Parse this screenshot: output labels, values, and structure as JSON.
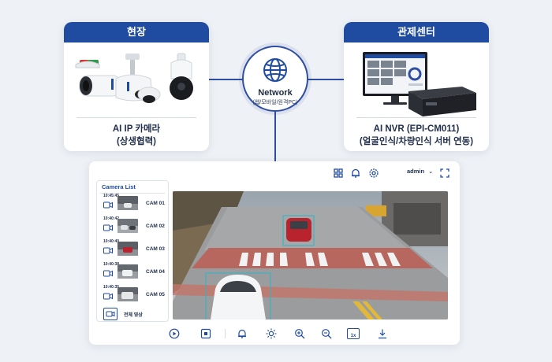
{
  "left_card": {
    "header": "현장",
    "caption_line1": "AI IP 카메라",
    "caption_line2": "(상생협력)"
  },
  "right_card": {
    "header": "관제센터",
    "caption_line1": "AI NVR (EPI-CM011)",
    "caption_line2": "(얼굴인식/차량인식 서버 연동)"
  },
  "hub": {
    "title": "Network",
    "subtitle": "(웹/모바일/원격PC)",
    "icon": "globe-icon"
  },
  "viewer": {
    "user": "admin",
    "camera_list_title": "Camera List",
    "cameras": [
      {
        "time": "10:45:45",
        "name": "CAM 01"
      },
      {
        "time": "10:40:42",
        "name": "CAM 02"
      },
      {
        "time": "10:40:40",
        "name": "CAM 03"
      },
      {
        "time": "10:40:38",
        "name": "CAM 04"
      },
      {
        "time": "10:40:35",
        "name": "CAM 05"
      }
    ],
    "all_view_label": "전체 영상",
    "speed_label": "1x",
    "colors": {
      "accent": "#1f4ba0",
      "detection_box": "#2bb5c9"
    }
  }
}
